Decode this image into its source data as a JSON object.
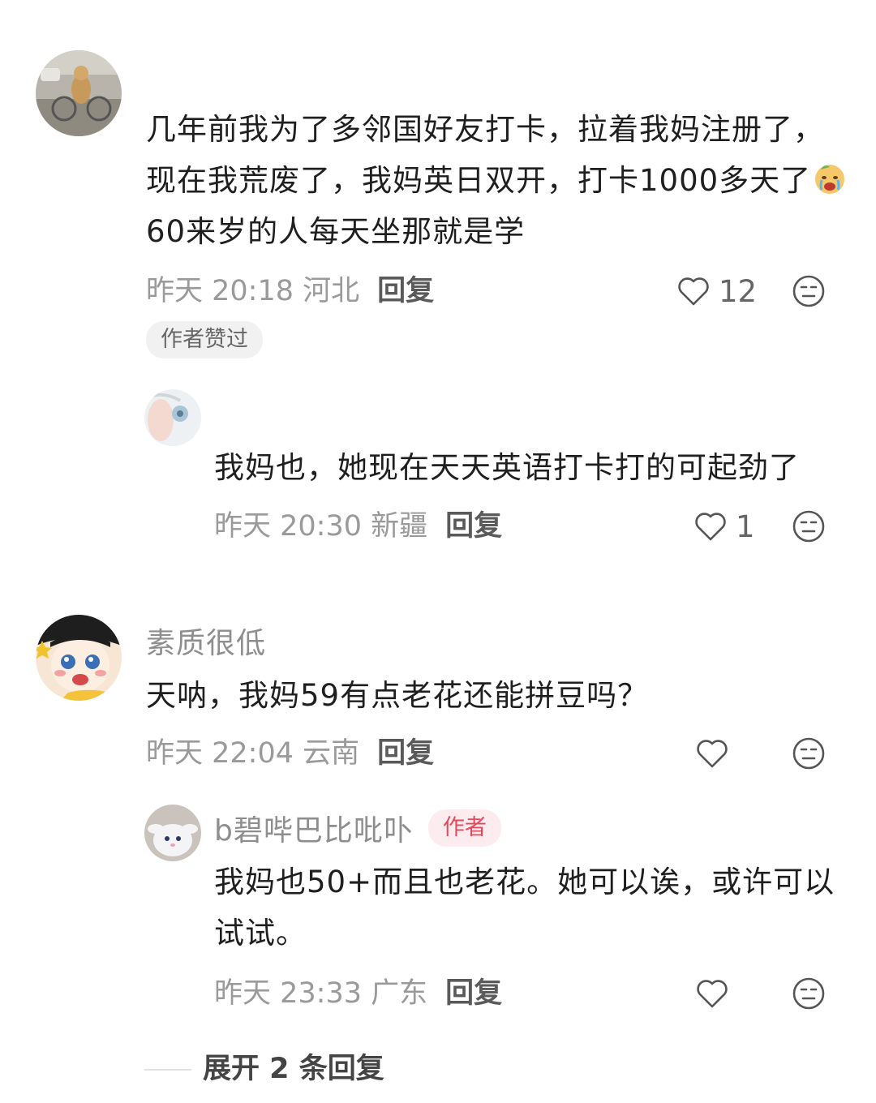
{
  "comments": [
    {
      "text": "几年前我为了多邻国好友打卡，拉着我妈注册了，现在我荒废了，我妈英日双开，打卡1000多天了",
      "text_tail": "60来岁的人每天坐那就是学",
      "time": "昨天 20:18 河北",
      "reply_label": "回复",
      "likes": "12",
      "badge": "作者赞过",
      "emoji_icon": "crying-emoji-icon"
    },
    {
      "text": "我妈也，她现在天天英语打卡打的可起劲了",
      "time": "昨天 20:30 新疆",
      "reply_label": "回复",
      "likes": "1"
    },
    {
      "name": "素质很低",
      "text": "天呐，我妈59有点老花还能拼豆吗？",
      "time": "昨天 22:04 云南",
      "reply_label": "回复",
      "likes": ""
    },
    {
      "name": "b碧哔巴比吡卟",
      "author_badge": "作者",
      "text": "我妈也50+而且也老花。她可以诶，或许可以试试。",
      "time": "昨天 23:33 广东",
      "reply_label": "回复",
      "likes": ""
    }
  ],
  "expand": {
    "label": "展开 2 条回复"
  },
  "colors": {
    "accent": "#e34a5b",
    "meta": "#9a9a9a",
    "badge_bg": "#f1f1f1"
  }
}
